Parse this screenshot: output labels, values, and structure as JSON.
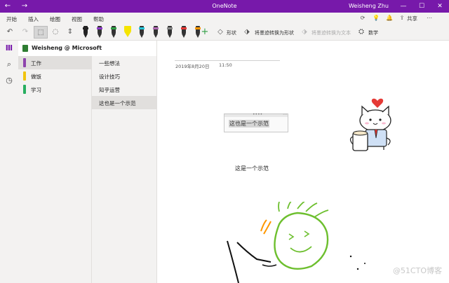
{
  "window": {
    "title": "OneNote",
    "user": "Weisheng Zhu",
    "back_icon": "←",
    "forward_icon": "→",
    "minimize_icon": "—",
    "maximize_icon": "☐",
    "close_icon": "✕"
  },
  "ribbon": {
    "tabs": [
      "开始",
      "插入",
      "绘图",
      "视图",
      "帮助"
    ],
    "active_tab": "绘图",
    "share_label": "共享"
  },
  "toolbar": {
    "shape_label": "形状",
    "ink_to_shape_label": "将墨迹转换为形状",
    "ink_to_text_label": "将墨迹转换为文本",
    "math_label": "数学",
    "add_icon": "+",
    "pens": [
      {
        "name": "black-pen",
        "color": "#222222",
        "band": "#222222",
        "type": "pen"
      },
      {
        "name": "purple-pen",
        "color": "#333333",
        "band": "#8e3cc8",
        "type": "pen"
      },
      {
        "name": "green-pen",
        "color": "#333333",
        "band": "#2f9e44",
        "type": "pen"
      },
      {
        "name": "yellow-highlighter",
        "color": "#333333",
        "band": "#f5e400",
        "type": "hl"
      },
      {
        "name": "cyan-pen",
        "color": "#333333",
        "band": "#26c6da",
        "type": "pen"
      },
      {
        "name": "galaxy-pen",
        "color": "#333333",
        "band": "#b06ab3",
        "type": "pen"
      },
      {
        "name": "silver-pen",
        "color": "#333333",
        "band": "#888888",
        "type": "pen"
      },
      {
        "name": "rainbow-pen",
        "color": "#333333",
        "band": "#e53935",
        "type": "pen"
      },
      {
        "name": "orange-pen",
        "color": "#333333",
        "band": "#ff9800",
        "type": "pen"
      }
    ]
  },
  "notebook": {
    "name": "Weisheng @ Microsoft",
    "chevron": "⌄",
    "sections": [
      {
        "label": "工作",
        "color": "#8e44ad",
        "selected": true
      },
      {
        "label": "做饭",
        "color": "#f1c40f",
        "selected": false
      },
      {
        "label": "学习",
        "color": "#27ae60",
        "selected": false
      }
    ],
    "pages": [
      {
        "label": "一些想法",
        "selected": false
      },
      {
        "label": "设计技巧",
        "selected": false
      },
      {
        "label": "知乎运营",
        "selected": false
      },
      {
        "label": "这也是一个示范",
        "selected": true
      }
    ]
  },
  "page": {
    "date": "2019年8月20日",
    "time": "11:50",
    "note_box_text": "这也是一个示范",
    "note_box_grip": "••••",
    "note_box_more": "⋯",
    "note_text": "这是一个示范"
  },
  "watermark": "@51CTO博客",
  "colors": {
    "accent": "#7719aa",
    "panel": "#f3f2f1",
    "selected": "#e1dfdd"
  }
}
